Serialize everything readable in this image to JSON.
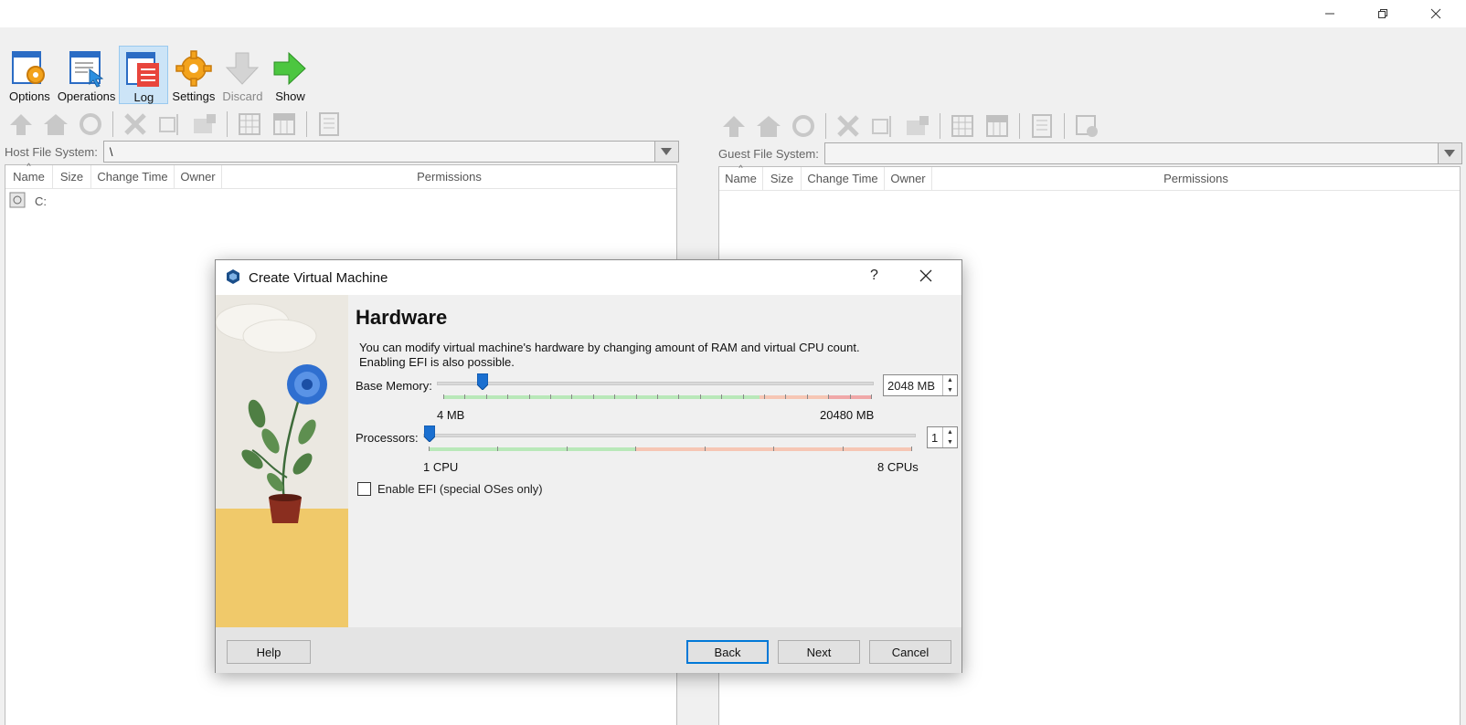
{
  "window": {
    "minimize_icon": "minimize-icon",
    "maximize_icon": "restore-icon",
    "close_icon": "close-icon"
  },
  "toolbar": {
    "items": [
      {
        "label": "Options",
        "icon": "options-gear-icon"
      },
      {
        "label": "Operations",
        "icon": "operations-cursor-icon"
      },
      {
        "label": "Log",
        "icon": "log-list-icon",
        "active": true
      },
      {
        "label": "Settings",
        "icon": "gear-icon"
      },
      {
        "label": "Discard",
        "icon": "arrow-down-icon",
        "disabled": true
      },
      {
        "label": "Show",
        "icon": "arrow-right-icon"
      }
    ]
  },
  "host": {
    "label": "Host File System:",
    "path": "\\",
    "columns": [
      "Name",
      "Size",
      "Change Time",
      "Owner",
      "Permissions"
    ],
    "rows": [
      {
        "name": "C:"
      }
    ]
  },
  "guest": {
    "label": "Guest File System:",
    "path": "",
    "columns": [
      "Name",
      "Size",
      "Change Time",
      "Owner",
      "Permissions"
    ]
  },
  "dialog": {
    "title": "Create Virtual Machine",
    "help_glyph": "?",
    "heading": "Hardware",
    "description_line1": "You can modify virtual machine's hardware by changing amount of RAM and virtual CPU count.",
    "description_line2": "Enabling EFI is also possible.",
    "memory": {
      "label": "Base Memory:",
      "value": "2048 MB",
      "min_label": "4 MB",
      "max_label": "20480 MB",
      "level": 0.1,
      "safe_fraction": 0.74
    },
    "processors": {
      "label": "Processors:",
      "value": "1",
      "min_label": "1 CPU",
      "max_label": "8 CPUs",
      "level": 0,
      "safe_fraction": 0.43
    },
    "efi": {
      "label": "Enable EFI (special OSes only)",
      "checked": false
    },
    "buttons": {
      "help": "Help",
      "back": "Back",
      "next": "Next",
      "cancel": "Cancel"
    }
  },
  "colors": {
    "safe": "#b9e8b9",
    "warn": "#f6c6b4",
    "danger": "#f0a8a8",
    "thumb": "#1a6fd0",
    "accent": "#0078d7"
  }
}
